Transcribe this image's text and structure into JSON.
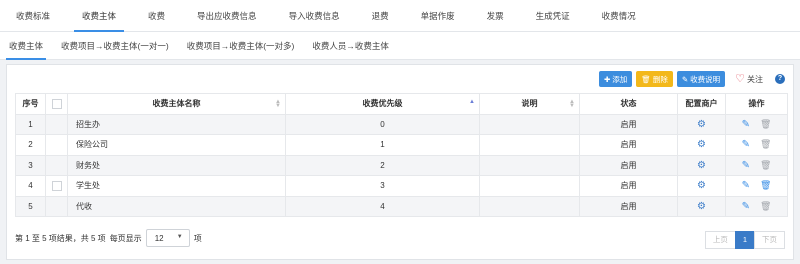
{
  "top_tabs": [
    "收费标准",
    "收费主体",
    "收费",
    "导出应收费信息",
    "导入收费信息",
    "退费",
    "单据作废",
    "发票",
    "生成凭证",
    "收费情况"
  ],
  "top_active": 1,
  "sub_tabs": [
    "收费主体",
    "收费项目→收费主体(一对一)",
    "收费项目→收费主体(一对多)",
    "收费人员→收费主体"
  ],
  "sub_active": 0,
  "toolbar": {
    "add": "添加",
    "delete": "删除",
    "explain": "收费说明",
    "follow": "关注",
    "help": "?"
  },
  "columns": [
    "序号",
    "收费主体名称",
    "收费优先级",
    "说明",
    "状态",
    "配置商户",
    "操作"
  ],
  "rows": [
    {
      "no": "1",
      "name": "招生办",
      "priority": "0",
      "desc": "",
      "status": "启用"
    },
    {
      "no": "2",
      "name": "保险公司",
      "priority": "1",
      "desc": "",
      "status": "启用"
    },
    {
      "no": "3",
      "name": "财务处",
      "priority": "2",
      "desc": "",
      "status": "启用"
    },
    {
      "no": "4",
      "name": "学生处",
      "priority": "3",
      "desc": "",
      "status": "启用"
    },
    {
      "no": "5",
      "name": "代收",
      "priority": "4",
      "desc": "",
      "status": "启用"
    }
  ],
  "footer": {
    "summary": "第 1 至 5 项结果，共 5 项",
    "per_page_label": "每页显示",
    "per_page_value": "12",
    "per_page_unit": "项"
  },
  "pager": {
    "prev": "上页",
    "current": "1",
    "next": "下页"
  },
  "colors": {
    "accent": "#3a8ee6",
    "warn": "#f3b81a",
    "heart": "#e04b5a"
  },
  "icons": {
    "add": "plus-icon",
    "delete": "trash-icon",
    "explain": "edit-icon",
    "follow": "heart-icon",
    "config": "gears-icon",
    "edit": "edit-icon"
  }
}
